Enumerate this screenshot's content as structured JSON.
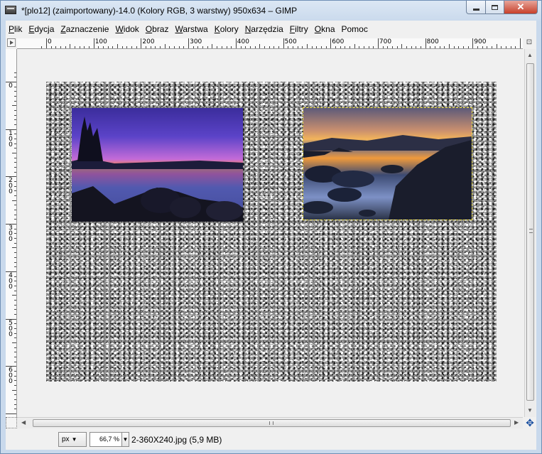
{
  "window": {
    "title": "*[plo12] (zaimportowany)-14.0 (Kolory RGB, 3 warstwy) 950x634 – GIMP",
    "controls": {
      "minimize": "minimize-icon",
      "maximize": "maximize-icon",
      "close": "✕"
    }
  },
  "menu": {
    "items": [
      {
        "accel": "P",
        "rest": "lik"
      },
      {
        "accel": "E",
        "rest": "dycja"
      },
      {
        "accel": "Z",
        "rest": "aznaczenie"
      },
      {
        "accel": "W",
        "rest": "idok"
      },
      {
        "accel": "O",
        "rest": "braz"
      },
      {
        "accel": "W",
        "rest": "arstwa"
      },
      {
        "accel": "K",
        "rest": "olory"
      },
      {
        "accel": "N",
        "rest": "arzędzia"
      },
      {
        "accel": "F",
        "rest": "iltry"
      },
      {
        "accel": "O",
        "rest": "kna"
      },
      {
        "accel": "",
        "rest": "Pomoc"
      }
    ]
  },
  "rulers": {
    "horizontal_labels": [
      "0",
      "100",
      "200",
      "300",
      "400",
      "500",
      "600",
      "700",
      "800",
      "900"
    ],
    "vertical_labels": [
      "0",
      "100",
      "200",
      "300",
      "400",
      "500",
      "600"
    ]
  },
  "statusbar": {
    "unit": "px",
    "zoom": "66,7 %",
    "info": "2-360X240.jpg (5,9 MB)"
  },
  "colors": {
    "selection_outline": "#f0e040",
    "canvas_background": "#f0f0f0"
  }
}
